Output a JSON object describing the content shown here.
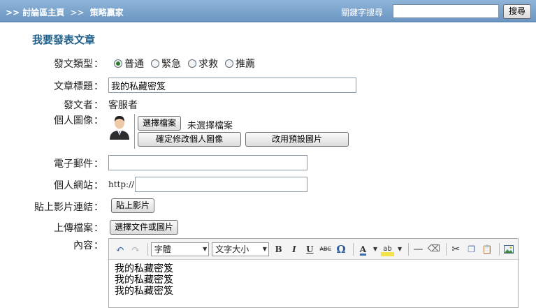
{
  "header": {
    "breadcrumb": {
      "prefix": ">>",
      "home": "討論區主頁",
      "sep": ">>",
      "current": "策略贏家"
    },
    "search": {
      "label": "關鍵字搜尋",
      "value": "",
      "button": "搜尋"
    }
  },
  "form": {
    "title": "我要發表文章",
    "type": {
      "label": "發文類型",
      "options": [
        "普通",
        "緊急",
        "求救",
        "推薦"
      ],
      "selected": "普通"
    },
    "subject": {
      "label": "文章標題",
      "value": "我的私藏密笈"
    },
    "author": {
      "label": "發文者",
      "value": "客服者"
    },
    "avatar": {
      "label": "個人圖像",
      "choose_button": "選擇檔案",
      "no_file_text": "未選擇檔案",
      "confirm_button": "確定修改個人圖像",
      "default_button": "改用預設圖片"
    },
    "email": {
      "label": "電子郵件",
      "value": ""
    },
    "website": {
      "label": "個人網站",
      "prefix": "http://",
      "value": ""
    },
    "video": {
      "label": "貼上影片連結",
      "button": "貼上影片"
    },
    "upload": {
      "label": "上傳檔案",
      "button": "選擇文件或圖片"
    },
    "content": {
      "label": "內容",
      "font_select": "字體",
      "size_select": "文字大小",
      "lines": [
        "我的私藏密笈",
        "我的私藏密笈",
        "我的私藏密笈"
      ]
    },
    "colon": "："
  },
  "colors": {
    "header_bg": "#7ba3cd",
    "title": "#1f5f8b",
    "radio_checked": "#2b7a2b"
  }
}
